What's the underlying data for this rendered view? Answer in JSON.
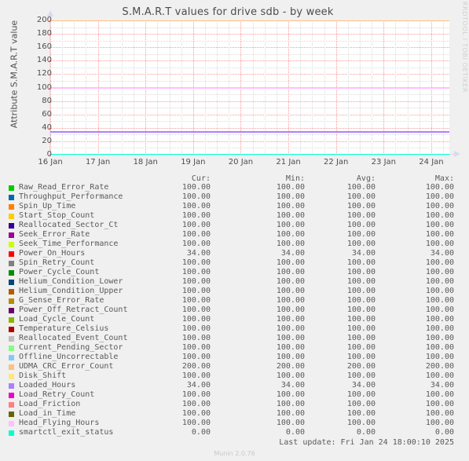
{
  "chart_data": {
    "type": "line",
    "title": "S.M.A.R.T values for drive sdb - by week",
    "xlabel": "",
    "ylabel": "Attribute S.M.A.R.T value",
    "ylim": [
      0,
      200
    ],
    "yticks": [
      0,
      20,
      40,
      60,
      80,
      100,
      120,
      140,
      160,
      180,
      200
    ],
    "xticks": [
      "16 Jan",
      "17 Jan",
      "18 Jan",
      "19 Jan",
      "20 Jan",
      "21 Jan",
      "22 Jan",
      "23 Jan",
      "24 Jan"
    ],
    "grid": true,
    "legend_position": "below",
    "series": [
      {
        "name": "Raw_Read_Error_Rate",
        "color": "#00cc00",
        "value": 100.0
      },
      {
        "name": "Throughput_Performance",
        "color": "#0066b3",
        "value": 100.0
      },
      {
        "name": "Spin_Up_Time",
        "color": "#ff8000",
        "value": 100.0
      },
      {
        "name": "Start_Stop_Count",
        "color": "#ffcc00",
        "value": 100.0
      },
      {
        "name": "Reallocated_Sector_Ct",
        "color": "#330099",
        "value": 100.0
      },
      {
        "name": "Seek_Error_Rate",
        "color": "#990099",
        "value": 100.0
      },
      {
        "name": "Seek_Time_Performance",
        "color": "#ccff00",
        "value": 100.0
      },
      {
        "name": "Power_On_Hours",
        "color": "#ff0000",
        "value": 34.0
      },
      {
        "name": "Spin_Retry_Count",
        "color": "#808080",
        "value": 100.0
      },
      {
        "name": "Power_Cycle_Count",
        "color": "#008f00",
        "value": 100.0
      },
      {
        "name": "Helium_Condition_Lower",
        "color": "#00487d",
        "value": 100.0
      },
      {
        "name": "Helium_Condition_Upper",
        "color": "#b35a00",
        "value": 100.0
      },
      {
        "name": "G_Sense_Error_Rate",
        "color": "#b38f00",
        "value": 100.0
      },
      {
        "name": "Power_Off_Retract_Count",
        "color": "#6b006b",
        "value": 100.0
      },
      {
        "name": "Load_Cycle_Count",
        "color": "#8fb300",
        "value": 100.0
      },
      {
        "name": "Temperature_Celsius",
        "color": "#b30000",
        "value": 100.0
      },
      {
        "name": "Reallocated_Event_Count",
        "color": "#bebebe",
        "value": 100.0
      },
      {
        "name": "Current_Pending_Sector",
        "color": "#80ff80",
        "value": 100.0
      },
      {
        "name": "Offline_Uncorrectable",
        "color": "#80c9ff",
        "value": 100.0
      },
      {
        "name": "UDMA_CRC_Error_Count",
        "color": "#ffc080",
        "value": 200.0
      },
      {
        "name": "Disk_Shift",
        "color": "#ffe680",
        "value": 100.0
      },
      {
        "name": "Loaded_Hours",
        "color": "#aa80ff",
        "value": 34.0
      },
      {
        "name": "Load_Retry_Count",
        "color": "#ee00cc",
        "value": 100.0
      },
      {
        "name": "Load_Friction",
        "color": "#ff8080",
        "value": 100.0
      },
      {
        "name": "Load_in_Time",
        "color": "#666600",
        "value": 100.0
      },
      {
        "name": "Head_Flying_Hours",
        "color": "#ffbfff",
        "value": 100.0
      },
      {
        "name": "smartctl_exit_status",
        "color": "#00ffcc",
        "value": 0.0
      }
    ],
    "visible_levels": [
      {
        "value": 200,
        "color": "#ff8000"
      },
      {
        "value": 100,
        "color": "#ee00cc"
      },
      {
        "value": 34,
        "color": "#aa80ff"
      },
      {
        "value": 0,
        "color": "#00ffcc"
      }
    ]
  },
  "graph": {
    "title": "S.M.A.R.T values for drive sdb - by week",
    "ylabel": "Attribute S.M.A.R.T value",
    "credit": "RRDTOOL / TOBI OETIKER",
    "ytick_labels": [
      "200",
      "180",
      "160",
      "140",
      "120",
      "100",
      "80",
      "60",
      "40",
      "20",
      "0"
    ],
    "xtick_labels": [
      "16 Jan",
      "17 Jan",
      "18 Jan",
      "19 Jan",
      "20 Jan",
      "21 Jan",
      "22 Jan",
      "23 Jan",
      "24 Jan"
    ]
  },
  "legend": {
    "headers": {
      "cur": "Cur:",
      "min": "Min:",
      "avg": "Avg:",
      "max": "Max:"
    },
    "rows": [
      {
        "label": "Raw_Read_Error_Rate",
        "color": "#00cc00",
        "cur": "100.00",
        "min": "100.00",
        "avg": "100.00",
        "max": "100.00"
      },
      {
        "label": "Throughput_Performance",
        "color": "#0066b3",
        "cur": "100.00",
        "min": "100.00",
        "avg": "100.00",
        "max": "100.00"
      },
      {
        "label": "Spin_Up_Time",
        "color": "#ff8000",
        "cur": "100.00",
        "min": "100.00",
        "avg": "100.00",
        "max": "100.00"
      },
      {
        "label": "Start_Stop_Count",
        "color": "#ffcc00",
        "cur": "100.00",
        "min": "100.00",
        "avg": "100.00",
        "max": "100.00"
      },
      {
        "label": "Reallocated_Sector_Ct",
        "color": "#330099",
        "cur": "100.00",
        "min": "100.00",
        "avg": "100.00",
        "max": "100.00"
      },
      {
        "label": "Seek_Error_Rate",
        "color": "#990099",
        "cur": "100.00",
        "min": "100.00",
        "avg": "100.00",
        "max": "100.00"
      },
      {
        "label": "Seek_Time_Performance",
        "color": "#ccff00",
        "cur": "100.00",
        "min": "100.00",
        "avg": "100.00",
        "max": "100.00"
      },
      {
        "label": "Power_On_Hours",
        "color": "#ff0000",
        "cur": "34.00",
        "min": "34.00",
        "avg": "34.00",
        "max": "34.00"
      },
      {
        "label": "Spin_Retry_Count",
        "color": "#808080",
        "cur": "100.00",
        "min": "100.00",
        "avg": "100.00",
        "max": "100.00"
      },
      {
        "label": "Power_Cycle_Count",
        "color": "#008f00",
        "cur": "100.00",
        "min": "100.00",
        "avg": "100.00",
        "max": "100.00"
      },
      {
        "label": "Helium_Condition_Lower",
        "color": "#00487d",
        "cur": "100.00",
        "min": "100.00",
        "avg": "100.00",
        "max": "100.00"
      },
      {
        "label": "Helium_Condition_Upper",
        "color": "#b35a00",
        "cur": "100.00",
        "min": "100.00",
        "avg": "100.00",
        "max": "100.00"
      },
      {
        "label": "G_Sense_Error_Rate",
        "color": "#b38f00",
        "cur": "100.00",
        "min": "100.00",
        "avg": "100.00",
        "max": "100.00"
      },
      {
        "label": "Power_Off_Retract_Count",
        "color": "#6b006b",
        "cur": "100.00",
        "min": "100.00",
        "avg": "100.00",
        "max": "100.00"
      },
      {
        "label": "Load_Cycle_Count",
        "color": "#8fb300",
        "cur": "100.00",
        "min": "100.00",
        "avg": "100.00",
        "max": "100.00"
      },
      {
        "label": "Temperature_Celsius",
        "color": "#b30000",
        "cur": "100.00",
        "min": "100.00",
        "avg": "100.00",
        "max": "100.00"
      },
      {
        "label": "Reallocated_Event_Count",
        "color": "#bebebe",
        "cur": "100.00",
        "min": "100.00",
        "avg": "100.00",
        "max": "100.00"
      },
      {
        "label": "Current_Pending_Sector",
        "color": "#80ff80",
        "cur": "100.00",
        "min": "100.00",
        "avg": "100.00",
        "max": "100.00"
      },
      {
        "label": "Offline_Uncorrectable",
        "color": "#80c9ff",
        "cur": "100.00",
        "min": "100.00",
        "avg": "100.00",
        "max": "100.00"
      },
      {
        "label": "UDMA_CRC_Error_Count",
        "color": "#ffc080",
        "cur": "200.00",
        "min": "200.00",
        "avg": "200.00",
        "max": "200.00"
      },
      {
        "label": "Disk_Shift",
        "color": "#ffe680",
        "cur": "100.00",
        "min": "100.00",
        "avg": "100.00",
        "max": "100.00"
      },
      {
        "label": "Loaded_Hours",
        "color": "#aa80ff",
        "cur": "34.00",
        "min": "34.00",
        "avg": "34.00",
        "max": "34.00"
      },
      {
        "label": "Load_Retry_Count",
        "color": "#ee00cc",
        "cur": "100.00",
        "min": "100.00",
        "avg": "100.00",
        "max": "100.00"
      },
      {
        "label": "Load_Friction",
        "color": "#ff8080",
        "cur": "100.00",
        "min": "100.00",
        "avg": "100.00",
        "max": "100.00"
      },
      {
        "label": "Load_in_Time",
        "color": "#666600",
        "cur": "100.00",
        "min": "100.00",
        "avg": "100.00",
        "max": "100.00"
      },
      {
        "label": "Head_Flying_Hours",
        "color": "#ffbfff",
        "cur": "100.00",
        "min": "100.00",
        "avg": "100.00",
        "max": "100.00"
      },
      {
        "label": "smartctl_exit_status",
        "color": "#00ffcc",
        "cur": "0.00",
        "min": "0.00",
        "avg": "0.00",
        "max": "0.00"
      }
    ]
  },
  "footer": {
    "last_update": "Last update: Fri Jan 24 18:00:10 2025",
    "munin_version": "Munin 2.0.76"
  }
}
